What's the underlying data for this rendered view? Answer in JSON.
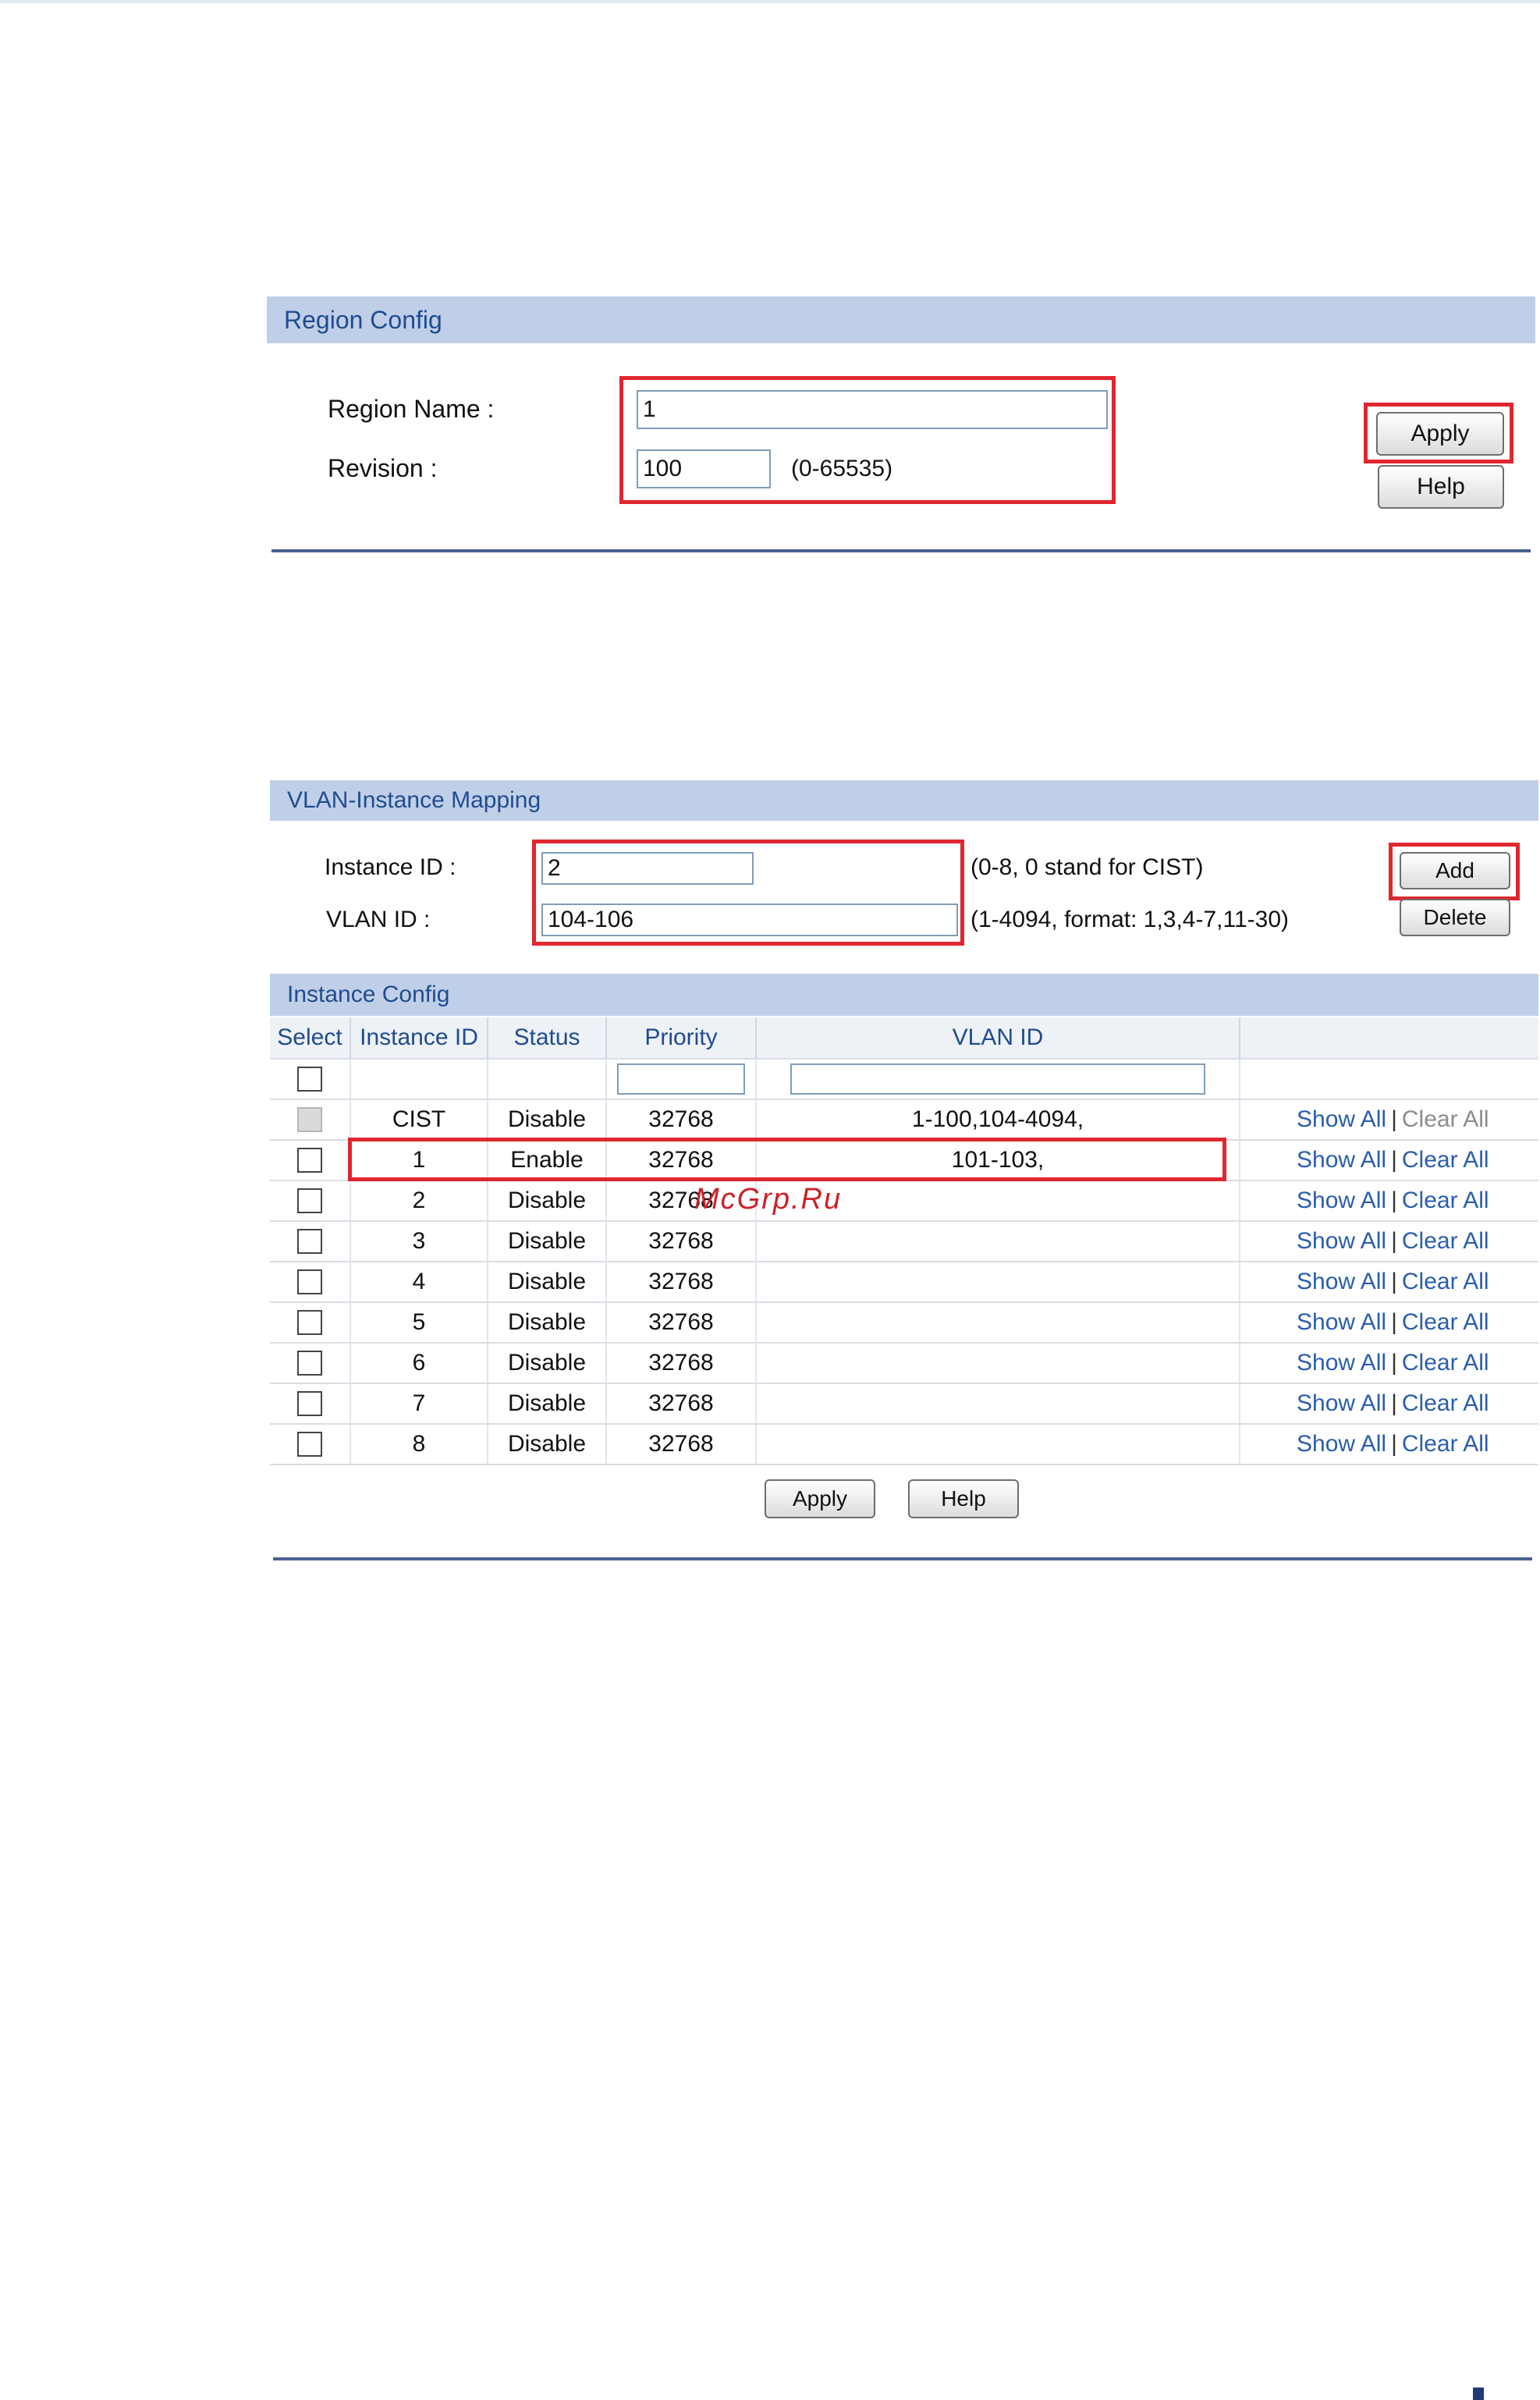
{
  "region_config": {
    "title": "Region Config",
    "region_name_label": "Region Name :",
    "region_name_value": "1",
    "revision_label": "Revision :",
    "revision_value": "100",
    "revision_hint": "(0-65535)",
    "apply_label": "Apply",
    "help_label": "Help"
  },
  "vlan_mapping": {
    "title": "VLAN-Instance Mapping",
    "instance_id_label": "Instance ID :",
    "instance_id_value": "2",
    "instance_id_hint": "(0-8, 0 stand for CIST)",
    "vlan_id_label": "VLAN ID :",
    "vlan_id_value": "104-106",
    "vlan_id_hint": "(1-4094, format: 1,3,4-7,11-30)",
    "add_label": "Add",
    "delete_label": "Delete"
  },
  "instance_config": {
    "title": "Instance Config",
    "columns": [
      "Select",
      "Instance ID",
      "Status",
      "Priority",
      "VLAN ID"
    ],
    "show_all_label": "Show All",
    "separator": "|",
    "clear_all_label": "Clear All",
    "rows": [
      {
        "id": "CIST",
        "status": "Disable",
        "priority": "32768",
        "vlan": "1-100,104-4094,",
        "select_disabled": true,
        "clear_disabled": true
      },
      {
        "id": "1",
        "status": "Enable",
        "priority": "32768",
        "vlan": "101-103,",
        "select_disabled": false,
        "clear_disabled": false
      },
      {
        "id": "2",
        "status": "Disable",
        "priority": "32768",
        "vlan": "",
        "select_disabled": false,
        "clear_disabled": false
      },
      {
        "id": "3",
        "status": "Disable",
        "priority": "32768",
        "vlan": "",
        "select_disabled": false,
        "clear_disabled": false
      },
      {
        "id": "4",
        "status": "Disable",
        "priority": "32768",
        "vlan": "",
        "select_disabled": false,
        "clear_disabled": false
      },
      {
        "id": "5",
        "status": "Disable",
        "priority": "32768",
        "vlan": "",
        "select_disabled": false,
        "clear_disabled": false
      },
      {
        "id": "6",
        "status": "Disable",
        "priority": "32768",
        "vlan": "",
        "select_disabled": false,
        "clear_disabled": false
      },
      {
        "id": "7",
        "status": "Disable",
        "priority": "32768",
        "vlan": "",
        "select_disabled": false,
        "clear_disabled": false
      },
      {
        "id": "8",
        "status": "Disable",
        "priority": "32768",
        "vlan": "",
        "select_disabled": false,
        "clear_disabled": false
      }
    ],
    "apply_label": "Apply",
    "help_label": "Help"
  },
  "watermark": "McGrp.Ru",
  "colors": {
    "panel_header_bg": "#c0cfe8",
    "panel_header_text": "#1f4c8f",
    "link": "#2a5db0",
    "highlight_box": "#e0262e",
    "separator": "#4a6190"
  }
}
